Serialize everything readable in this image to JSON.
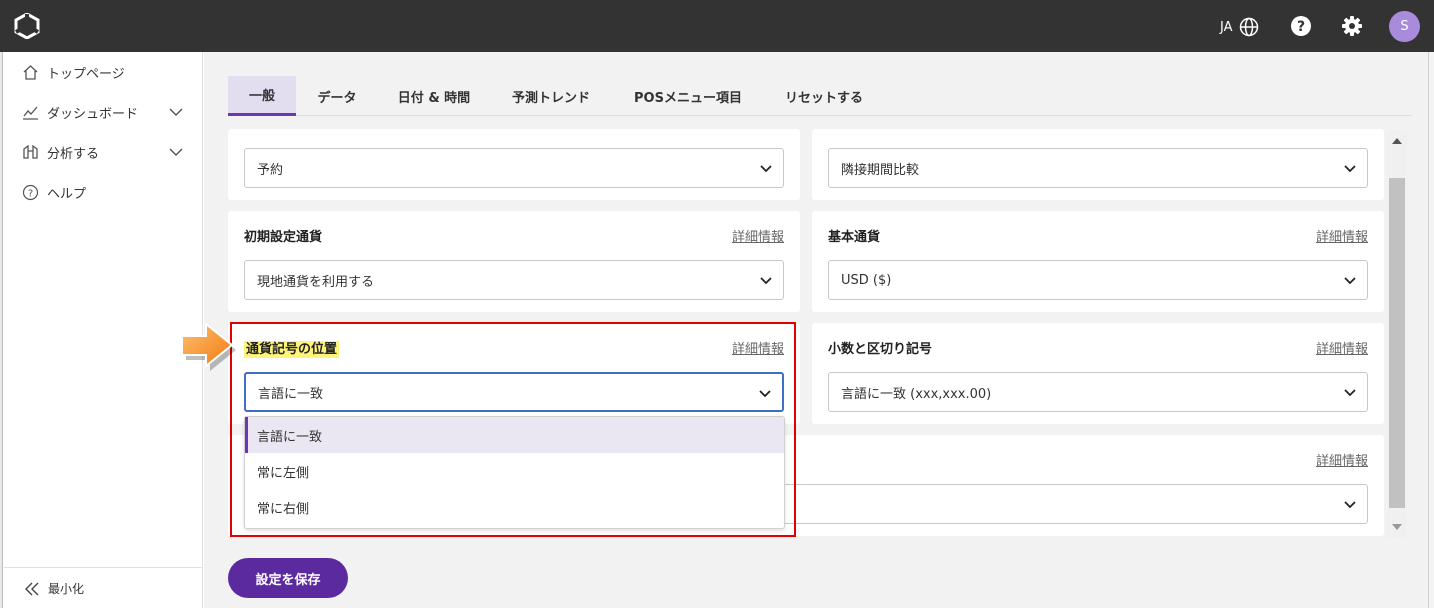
{
  "topbar": {
    "language": "JA",
    "avatar_initial": "S"
  },
  "sidebar": {
    "items": [
      {
        "label": "トップページ",
        "icon": "home-icon"
      },
      {
        "label": "ダッシュボード",
        "icon": "chart-icon"
      },
      {
        "label": "分析する",
        "icon": "binoculars-icon"
      },
      {
        "label": "ヘルプ",
        "icon": "help-circle-icon"
      }
    ],
    "minimize_label": "最小化"
  },
  "tabs": [
    {
      "label": "一般",
      "active": true
    },
    {
      "label": "データ"
    },
    {
      "label": "日付 & 時間"
    },
    {
      "label": "予測トレンド"
    },
    {
      "label": "POSメニュー項目"
    },
    {
      "label": "リセットする"
    }
  ],
  "cards": {
    "top_left": {
      "value": "予約"
    },
    "top_right": {
      "value": "隣接期間比較"
    },
    "default_currency": {
      "label": "初期設定通貨",
      "link": "詳細情報",
      "value": "現地通貨を利用する"
    },
    "base_currency": {
      "label": "基本通貨",
      "link": "詳細情報",
      "value": "USD ($)"
    },
    "symbol_position": {
      "label": "通貨記号の位置",
      "link": "詳細情報",
      "value": "言語に一致"
    },
    "decimal_separator": {
      "label": "小数と区切り記号",
      "link": "詳細情報",
      "value": "言語に一致 (xxx,xxx.00)"
    },
    "hidden_card": {
      "link": "詳細情報"
    }
  },
  "dropdown": {
    "options": [
      "言語に一致",
      "常に左側",
      "常に右側"
    ],
    "selected_index": 0
  },
  "save_button": "設定を保存",
  "colors": {
    "accent": "#5b2a9e",
    "topbar": "#333333",
    "highlight": "#fff47a",
    "annotation_box": "#e00000",
    "annotation_arrow": "#f7941d"
  }
}
